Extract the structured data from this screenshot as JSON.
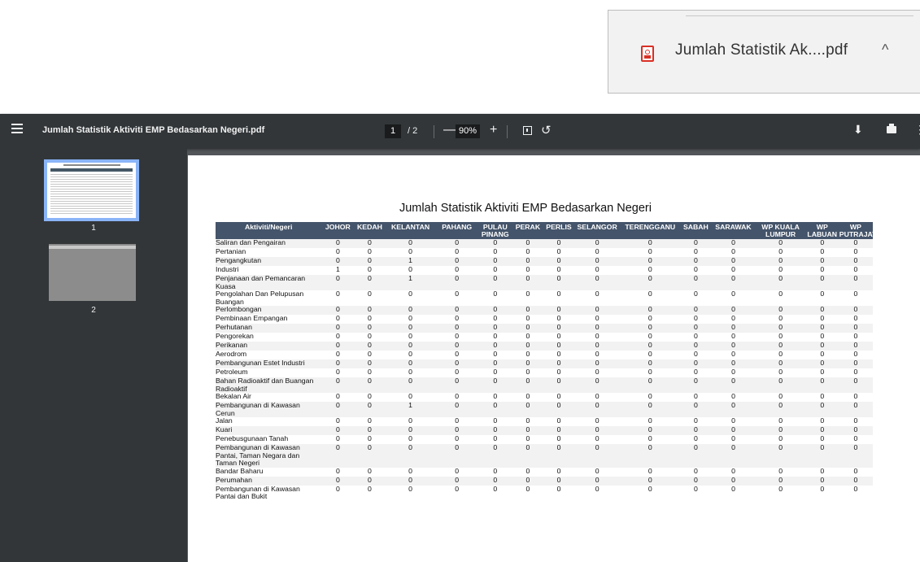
{
  "download": {
    "filename": "Jumlah Statistik Ak....pdf",
    "icon": "pdf-file-icon",
    "chevron": "^"
  },
  "toolbar": {
    "title": "Jumlah Statistik Aktiviti EMP Bedasarkan Negeri.pdf",
    "page_current": "1",
    "page_total": "/ 2",
    "zoom": "90%",
    "minus": "—",
    "plus": "+",
    "rotate": "↺",
    "download_glyph": "⬇",
    "more_glyph": "⋮"
  },
  "sidebar": {
    "thumbs": [
      {
        "label": "1"
      },
      {
        "label": "2"
      }
    ]
  },
  "document": {
    "title": "Jumlah Statistik Aktiviti EMP Bedasarkan Negeri",
    "headers": [
      "Aktiviti/Negeri",
      "JOHOR",
      "KEDAH",
      "KELANTAN",
      "PAHANG",
      "PULAU PINANG",
      "PERAK",
      "PERLIS",
      "SELANGOR",
      "TERENGGANU",
      "SABAH",
      "SARAWAK",
      "WP KUALA LUMPUR",
      "WP LABUAN",
      "WP PUTRAJAYA"
    ],
    "rows": [
      [
        "Saliran dan Pengairan",
        "0",
        "0",
        "0",
        "0",
        "0",
        "0",
        "0",
        "0",
        "0",
        "0",
        "0",
        "0",
        "0",
        "0"
      ],
      [
        "Pertanian",
        "0",
        "0",
        "0",
        "0",
        "0",
        "0",
        "0",
        "0",
        "0",
        "0",
        "0",
        "0",
        "0",
        "0"
      ],
      [
        "Pengangkutan",
        "0",
        "0",
        "1",
        "0",
        "0",
        "0",
        "0",
        "0",
        "0",
        "0",
        "0",
        "0",
        "0",
        "0"
      ],
      [
        "Industri",
        "1",
        "0",
        "0",
        "0",
        "0",
        "0",
        "0",
        "0",
        "0",
        "0",
        "0",
        "0",
        "0",
        "0"
      ],
      [
        "Penjanaan dan Pemancaran Kuasa",
        "0",
        "0",
        "1",
        "0",
        "0",
        "0",
        "0",
        "0",
        "0",
        "0",
        "0",
        "0",
        "0",
        "0"
      ],
      [
        "Pengolahan Dan Pelupusan Buangan",
        "0",
        "0",
        "0",
        "0",
        "0",
        "0",
        "0",
        "0",
        "0",
        "0",
        "0",
        "0",
        "0",
        "0"
      ],
      [
        "Perlombongan",
        "0",
        "0",
        "0",
        "0",
        "0",
        "0",
        "0",
        "0",
        "0",
        "0",
        "0",
        "0",
        "0",
        "0"
      ],
      [
        "Pembinaan Empangan",
        "0",
        "0",
        "0",
        "0",
        "0",
        "0",
        "0",
        "0",
        "0",
        "0",
        "0",
        "0",
        "0",
        "0"
      ],
      [
        "Perhutanan",
        "0",
        "0",
        "0",
        "0",
        "0",
        "0",
        "0",
        "0",
        "0",
        "0",
        "0",
        "0",
        "0",
        "0"
      ],
      [
        "Pengorekan",
        "0",
        "0",
        "0",
        "0",
        "0",
        "0",
        "0",
        "0",
        "0",
        "0",
        "0",
        "0",
        "0",
        "0"
      ],
      [
        "Perikanan",
        "0",
        "0",
        "0",
        "0",
        "0",
        "0",
        "0",
        "0",
        "0",
        "0",
        "0",
        "0",
        "0",
        "0"
      ],
      [
        "Aerodrom",
        "0",
        "0",
        "0",
        "0",
        "0",
        "0",
        "0",
        "0",
        "0",
        "0",
        "0",
        "0",
        "0",
        "0"
      ],
      [
        "Pembangunan Estet Industri",
        "0",
        "0",
        "0",
        "0",
        "0",
        "0",
        "0",
        "0",
        "0",
        "0",
        "0",
        "0",
        "0",
        "0"
      ],
      [
        "Petroleum",
        "0",
        "0",
        "0",
        "0",
        "0",
        "0",
        "0",
        "0",
        "0",
        "0",
        "0",
        "0",
        "0",
        "0"
      ],
      [
        "Bahan Radioaktif dan Buangan Radioaktif",
        "0",
        "0",
        "0",
        "0",
        "0",
        "0",
        "0",
        "0",
        "0",
        "0",
        "0",
        "0",
        "0",
        "0"
      ],
      [
        "Bekalan Air",
        "0",
        "0",
        "0",
        "0",
        "0",
        "0",
        "0",
        "0",
        "0",
        "0",
        "0",
        "0",
        "0",
        "0"
      ],
      [
        "Pembangunan di Kawasan Cerun",
        "0",
        "0",
        "1",
        "0",
        "0",
        "0",
        "0",
        "0",
        "0",
        "0",
        "0",
        "0",
        "0",
        "0"
      ],
      [
        "Jalan",
        "0",
        "0",
        "0",
        "0",
        "0",
        "0",
        "0",
        "0",
        "0",
        "0",
        "0",
        "0",
        "0",
        "0"
      ],
      [
        "Kuari",
        "0",
        "0",
        "0",
        "0",
        "0",
        "0",
        "0",
        "0",
        "0",
        "0",
        "0",
        "0",
        "0",
        "0"
      ],
      [
        "Penebusgunaan Tanah",
        "0",
        "0",
        "0",
        "0",
        "0",
        "0",
        "0",
        "0",
        "0",
        "0",
        "0",
        "0",
        "0",
        "0"
      ],
      [
        "Pembangunan di Kawasan Pantai, Taman Negara dan Taman Negeri",
        "0",
        "0",
        "0",
        "0",
        "0",
        "0",
        "0",
        "0",
        "0",
        "0",
        "0",
        "0",
        "0",
        "0"
      ],
      [
        "Bandar Baharu",
        "0",
        "0",
        "0",
        "0",
        "0",
        "0",
        "0",
        "0",
        "0",
        "0",
        "0",
        "0",
        "0",
        "0"
      ],
      [
        "Perumahan",
        "0",
        "0",
        "0",
        "0",
        "0",
        "0",
        "0",
        "0",
        "0",
        "0",
        "0",
        "0",
        "0",
        "0"
      ],
      [
        "Pembangunan di Kawasan Pantai dan Bukit",
        "0",
        "0",
        "0",
        "0",
        "0",
        "0",
        "0",
        "0",
        "0",
        "0",
        "0",
        "0",
        "0",
        "0"
      ]
    ]
  }
}
